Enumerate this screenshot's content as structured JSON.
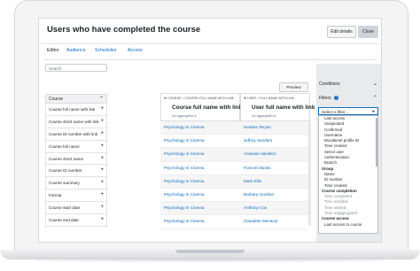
{
  "page": {
    "title": "Users who have completed the course",
    "buttons": {
      "edit": "Edit details",
      "close": "Close"
    },
    "tabs": [
      {
        "label": "Editor",
        "active": true
      },
      {
        "label": "Audience",
        "active": false
      },
      {
        "label": "Schedules",
        "active": false
      },
      {
        "label": "Access",
        "active": false
      }
    ]
  },
  "sidebar": {
    "search_placeholder": "Search",
    "section_title": "Course",
    "fields": [
      "Course full name with link",
      "Course short name with link",
      "Course ID number with link",
      "Course full name",
      "Course short name",
      "Course ID number",
      "Course summary",
      "Format",
      "Course start date",
      "Course end date"
    ]
  },
  "report": {
    "preview_label": "Preview",
    "columns": [
      {
        "source": "COURSE > COURSE FULL NAME WITH LINK",
        "title": "Course full name with link",
        "aggregation": "No aggregation"
      },
      {
        "source": "USER > FULL NAME WITH LINK",
        "title": "User full name with link",
        "aggregation": "No aggregation"
      }
    ],
    "rows": [
      [
        "Psychology in Cinema",
        "Heather Reyes"
      ],
      [
        "Psychology in Cinema",
        "Jeffrey Sanders"
      ],
      [
        "Psychology in Cinema",
        "Amanda Hamilton"
      ],
      [
        "Psychology in Cinema",
        "Frances Banks"
      ],
      [
        "Psychology in Cinema",
        "Mark Ellis"
      ],
      [
        "Psychology in Cinema",
        "Barbara Gardner"
      ],
      [
        "Psychology in Cinema",
        "Anthony Cox"
      ],
      [
        "Psychology in Cinema",
        "Claudette Menasol"
      ]
    ]
  },
  "rightpanel": {
    "conditions_label": "Conditions",
    "filters_label": "Filters",
    "select_label": "Select a filter...",
    "options": [
      {
        "label": "Last access",
        "kind": "item"
      },
      {
        "label": "Suspended",
        "kind": "item"
      },
      {
        "label": "Confirmed",
        "kind": "item"
      },
      {
        "label": "Username",
        "kind": "item"
      },
      {
        "label": "Moodlenet profile ID",
        "kind": "item"
      },
      {
        "label": "Time created",
        "kind": "item"
      },
      {
        "label": "Select user",
        "kind": "item"
      },
      {
        "label": "Authentication",
        "kind": "item"
      },
      {
        "label": "Branch",
        "kind": "item"
      },
      {
        "label": "Group",
        "kind": "group"
      },
      {
        "label": "Name",
        "kind": "item"
      },
      {
        "label": "ID number",
        "kind": "item"
      },
      {
        "label": "Time created",
        "kind": "item"
      },
      {
        "label": "Course completion",
        "kind": "group"
      },
      {
        "label": "Time completed",
        "kind": "disabled"
      },
      {
        "label": "Time enrolled",
        "kind": "disabled"
      },
      {
        "label": "Time started",
        "kind": "disabled"
      },
      {
        "label": "Time reaggregated",
        "kind": "disabled"
      },
      {
        "label": "Course access",
        "kind": "group"
      },
      {
        "label": "Last access to course",
        "kind": "item"
      }
    ]
  }
}
